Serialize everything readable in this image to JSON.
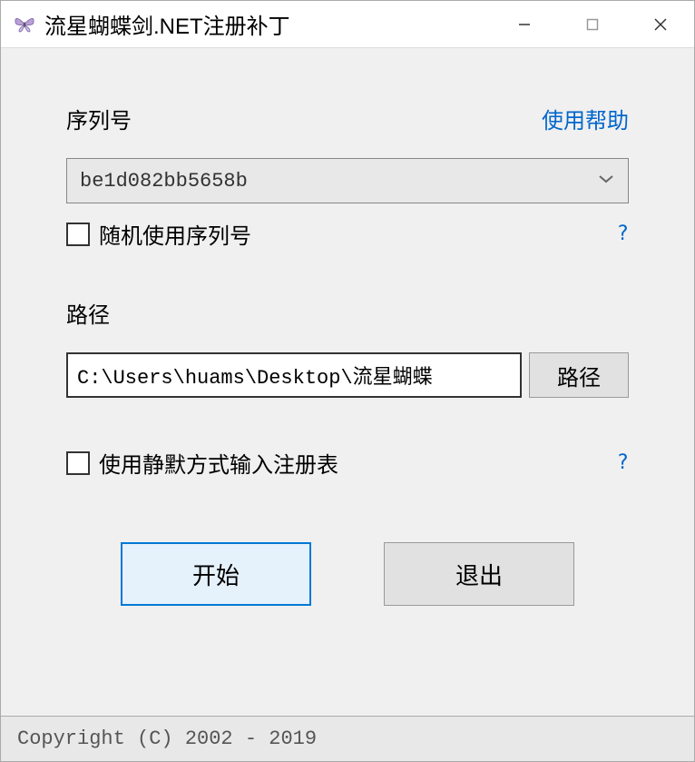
{
  "window": {
    "title": "流星蝴蝶剑.NET注册补丁"
  },
  "serial": {
    "label": "序列号",
    "help_link": "使用帮助",
    "value": "be1d082bb5658b",
    "random_checkbox_label": "随机使用序列号",
    "help_icon": "?"
  },
  "path": {
    "label": "路径",
    "value": "C:\\Users\\huams\\Desktop\\流星蝴蝶",
    "browse_button": "路径"
  },
  "silent": {
    "checkbox_label": "使用静默方式输入注册表",
    "help_icon": "?"
  },
  "buttons": {
    "start": "开始",
    "exit": "退出"
  },
  "footer": {
    "copyright": "Copyright (C) 2002 - 2019"
  }
}
